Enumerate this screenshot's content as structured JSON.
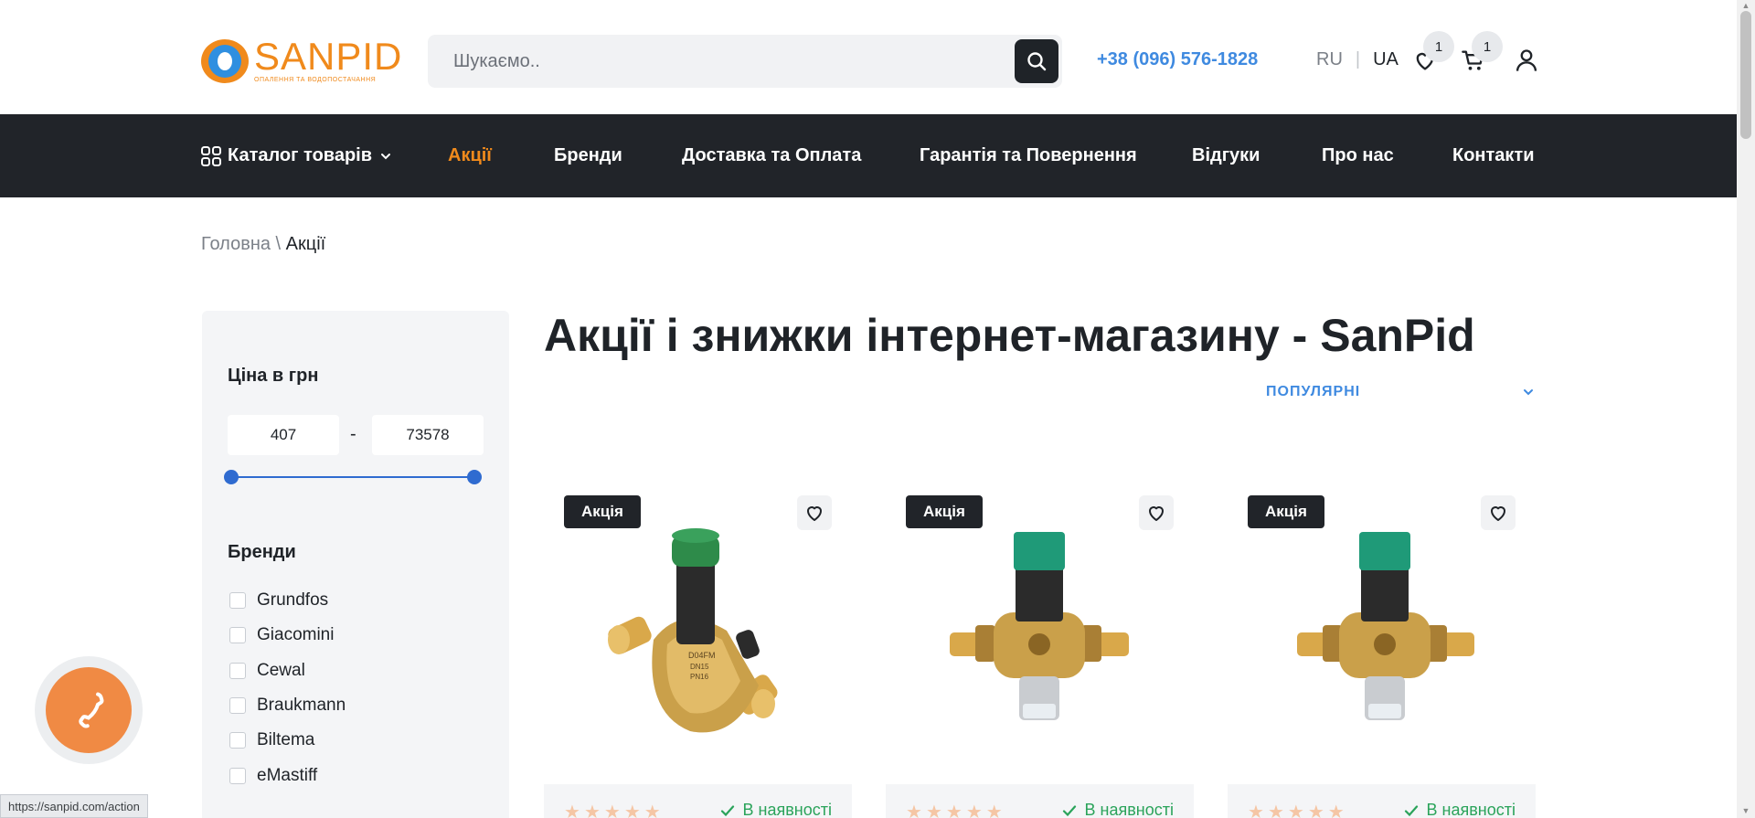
{
  "header": {
    "logo_name": "SANPID",
    "logo_sub": "ОПАЛЕННЯ ТА ВОДОПОСТАЧАННЯ",
    "search_placeholder": "Шукаємо..",
    "phone": "+38 (096) 576-1828",
    "lang_ru": "RU",
    "lang_sep": "|",
    "lang_ua": "UA",
    "wishlist_count": "1",
    "cart_count": "1"
  },
  "nav": {
    "catalog": "Каталог товарів",
    "items": [
      "Акції",
      "Бренди",
      "Доставка та Оплата",
      "Гарантія та Повернення",
      "Відгуки",
      "Про нас",
      "Контакти"
    ]
  },
  "breadcrumb": {
    "home": "Головна",
    "separator": " \\ ",
    "current": "Акції"
  },
  "sidebar": {
    "price_title": "Ціна в грн",
    "price_min": "407",
    "price_max": "73578",
    "price_dash": "-",
    "price_range_fraction": [
      0,
      1
    ],
    "brands_title": "Бренди",
    "brands": [
      "Grundfos",
      "Giacomini",
      "Cewal",
      "Braukmann",
      "Biltema",
      "eMastiff"
    ]
  },
  "main": {
    "title": "Акції і знижки інтернет-магазину - SanPid",
    "sort_label": "ПОПУЛЯРНІ"
  },
  "products": [
    {
      "tag": "Акція",
      "stock": "В наявності",
      "rating": 0
    },
    {
      "tag": "Акція",
      "stock": "В наявності",
      "rating": 0
    },
    {
      "tag": "Акція",
      "stock": "В наявності",
      "rating": 0
    }
  ],
  "status_url": "https://sanpid.com/action",
  "colors": {
    "brand_orange": "#f08a1c",
    "link_blue": "#3f8ae0",
    "dark": "#212429",
    "stock_green": "#2aa35a",
    "slider_blue": "#2f6bd0"
  }
}
